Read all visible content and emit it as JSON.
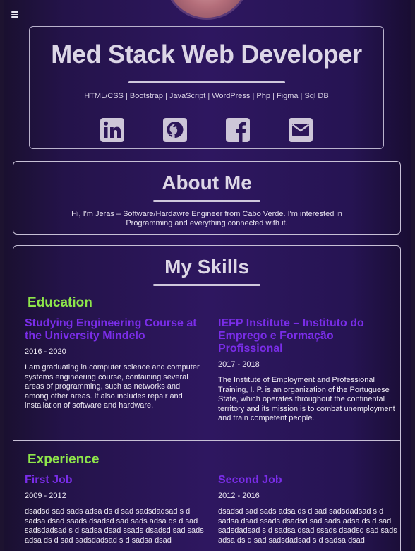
{
  "nav": {
    "menu_icon": "hamburger-icon"
  },
  "hero": {
    "title": "Med Stack Web Developer",
    "tech_stack": "HTML/CSS | Bootstrap | JavaScript | WordPress | Php | Figma | Sql DB",
    "socials": [
      {
        "name": "linkedin",
        "icon": "linkedin-icon"
      },
      {
        "name": "github",
        "icon": "github-icon"
      },
      {
        "name": "facebook",
        "icon": "facebook-icon"
      },
      {
        "name": "email",
        "icon": "envelope-icon"
      }
    ]
  },
  "about": {
    "title": "About Me",
    "text": "Hi, I'm Jeras – Software/Hardawre Engineer from Cabo Verde. I'm interested in Programming and everything connected with it."
  },
  "skills": {
    "title": "My Skills",
    "education": {
      "heading": "Education",
      "items": [
        {
          "title": "Studying Engineering Course at the University Mindelo",
          "date": "2016 - 2020",
          "text": "I am graduating in computer science and computer systems engineering course, containing several areas of programming, such as networks and among other areas. It also includes repair and installation of software and hardware."
        },
        {
          "title": "IEFP Institute – Instituto do Emprego e Formação Profissional",
          "date": "2017 - 2018",
          "text": "The Institute of Employment and Professional Training, I. P. is an organization of the Portuguese State, which operates throughout the continental territory and its mission is to combat unemployment and train competent people."
        }
      ]
    },
    "experience": {
      "heading": "Experience",
      "items": [
        {
          "title": "First Job",
          "date": "2009 - 2012",
          "text": "dsadsd sad sads adsa ds d sad sadsdadsad s d sadsa dsad ssads dsadsd sad sads adsa ds d sad sadsdadsad s d sadsa dsad ssads dsadsd sad sads adsa ds d sad sadsdadsad s d sadsa dsad"
        },
        {
          "title": "Second Job",
          "date": "2012 - 2016",
          "text": "dsadsd sad sads adsa ds d sad sadsdadsad s d sadsa dsad ssads dsadsd sad sads adsa ds d sad sadsdadsad s d sadsa dsad ssads dsadsd sad sads adsa ds d sad sadsdadsad s d sadsa dsad"
        }
      ]
    }
  },
  "colors": {
    "accent_purple": "#7a2de8",
    "accent_green": "#8ee64a"
  }
}
